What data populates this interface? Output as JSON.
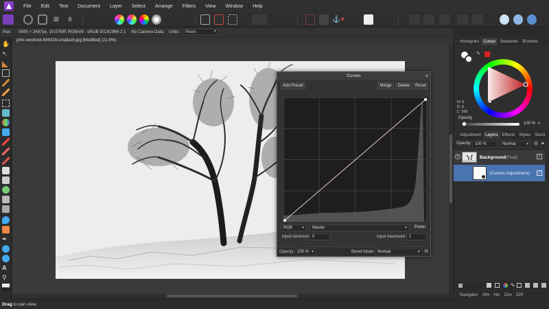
{
  "menubar": {
    "items": [
      "File",
      "Edit",
      "Text",
      "Document",
      "Layer",
      "Select",
      "Arrange",
      "Filters",
      "View",
      "Window",
      "Help"
    ]
  },
  "context": {
    "tool": "Pan",
    "info": "5595 × 3497px, 19.57MP, RGBA/8 · sRGB IEC61966-2.1",
    "camera": "No Camera Data",
    "units_label": "Units:",
    "units_value": "Pixels"
  },
  "document": {
    "tab_title": "john-westrock-648319-unsplash.jpg [Modified] (21.9%)"
  },
  "curves": {
    "title": "Curves",
    "add_preset": "Add Preset",
    "merge": "Merge",
    "delete": "Delete",
    "reset": "Reset",
    "channel_space": "RGB",
    "channel": "Master",
    "picker": "Picker",
    "input_min_label": "Input minimum:",
    "input_min_value": "0",
    "input_max_label": "Input maximum:",
    "input_max_value": "1",
    "opacity_label": "Opacity:",
    "opacity_value": "100 %",
    "blend_label": "Blend Mode:",
    "blend_value": "Normal"
  },
  "colour_panel": {
    "tabs": [
      "Histogram",
      "Colour",
      "Swatches",
      "Brushes"
    ],
    "active_tab": "Colour",
    "h": "H: 0",
    "s": "S: 0",
    "l": "L: 100",
    "opacity_label": "Opacity",
    "opacity_value": "100 %"
  },
  "layers_panel": {
    "tabs": [
      "Adjustment",
      "Layers",
      "Effects",
      "Styles",
      "Stock"
    ],
    "active_tab": "Layers",
    "opacity_label": "Opacity:",
    "opacity_value": "100 %",
    "blend_value": "Normal",
    "layers": [
      {
        "name": "Background",
        "type": "(Pixel)"
      },
      {
        "name": "(Curves Adjustment)",
        "type": ""
      }
    ]
  },
  "navigator_panel": {
    "tabs": [
      "Navigator",
      "Xfm",
      "His",
      "Chn",
      "32P"
    ]
  },
  "status": {
    "bold": "Drag",
    "text": " to pan view."
  },
  "colors": {
    "accent_blue": "#4a74b0",
    "curve_line": "#e8c8c8"
  }
}
